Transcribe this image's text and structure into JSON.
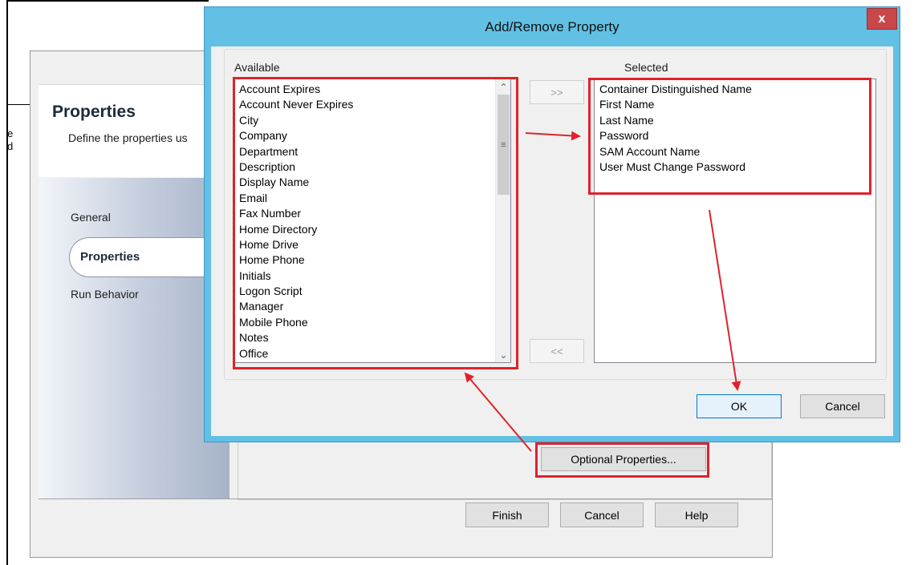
{
  "background": {
    "edge_text": [
      "e",
      "d"
    ],
    "wizard": {
      "title": "Properties",
      "subtitle": "Define the properties us",
      "nav_items": [
        "General",
        "Properties",
        "Run Behavior"
      ],
      "optional_button": "Optional Properties...",
      "footer_buttons": {
        "finish": "Finish",
        "cancel": "Cancel",
        "help": "Help"
      }
    }
  },
  "dialog": {
    "title": "Add/Remove Property",
    "close_label": "x",
    "available_label": "Available",
    "selected_label": "Selected",
    "available_items": [
      "Account Expires",
      "Account Never Expires",
      "City",
      "Company",
      "Department",
      "Description",
      "Display Name",
      "Email",
      "Fax Number",
      "Home Directory",
      "Home Drive",
      "Home Phone",
      "Initials",
      "Logon Script",
      "Manager",
      "Mobile Phone",
      "Notes",
      "Office"
    ],
    "selected_items": [
      "Container Distinguished Name",
      "First Name",
      "Last Name",
      "Password",
      "SAM Account Name",
      "User Must Change Password"
    ],
    "add_button": ">>",
    "remove_button": "<<",
    "ok_button": "OK",
    "cancel_button": "Cancel"
  },
  "scrollbar": {
    "up_icon": "chevron-up-icon",
    "down_icon": "chevron-down-icon",
    "thumb_grip_icon": "grip-icon"
  },
  "colors": {
    "annotation_red": "#e0222a",
    "titlebar": "#62c0e4",
    "close_button": "#c7474a"
  }
}
